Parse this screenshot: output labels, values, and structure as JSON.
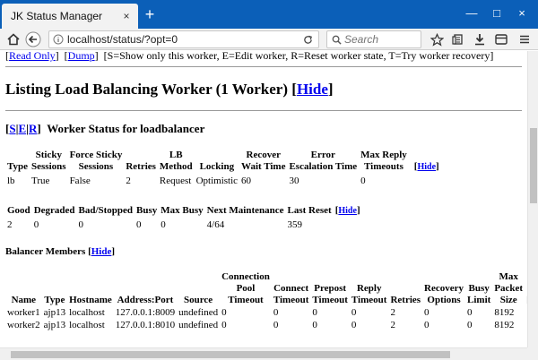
{
  "browser": {
    "tab_title": "JK Status Manager",
    "tab_close": "×",
    "new_tab": "+",
    "window_controls": {
      "minimize": "—",
      "maximize": "□",
      "close": "×"
    },
    "url": "localhost/status/?opt=0",
    "search_placeholder": "Search"
  },
  "page": {
    "top_links": {
      "read_only": "Read Only",
      "dump": "Dump",
      "description": "[S=Show only this worker, E=Edit worker, R=Reset worker state, T=Try worker recovery]"
    },
    "heading": "Listing Load Balancing Worker (1 Worker)",
    "heading_hide": "Hide",
    "worker_status": {
      "links": [
        "S",
        "E",
        "R"
      ],
      "title": "Worker Status for loadbalancer"
    },
    "hide_label": "Hide",
    "table1": {
      "headers": [
        [
          "",
          "Type"
        ],
        [
          "Sticky",
          "Sessions"
        ],
        [
          "Force Sticky",
          "Sessions"
        ],
        [
          "",
          "Retries"
        ],
        [
          "LB",
          "Method"
        ],
        [
          "",
          "Locking"
        ],
        [
          "Recover",
          "Wait Time"
        ],
        [
          "Error",
          "Escalation Time"
        ],
        [
          "Max Reply",
          "Timeouts"
        ]
      ],
      "row": [
        "lb",
        "True",
        "False",
        "2",
        "Request",
        "Optimistic",
        "60",
        "30",
        "0"
      ]
    },
    "table2": {
      "headers": [
        "Good",
        "Degraded",
        "Bad/Stopped",
        "Busy",
        "Max Busy",
        "Next Maintenance",
        "Last Reset"
      ],
      "row": [
        "2",
        "0",
        "0",
        "0",
        "0",
        "4/64",
        "359"
      ]
    },
    "members": {
      "title": "Balancer Members",
      "headers": [
        [
          "",
          "",
          "Name"
        ],
        [
          "",
          "",
          "Type"
        ],
        [
          "",
          "",
          "Hostname"
        ],
        [
          "",
          "",
          "Address:Port"
        ],
        [
          "",
          "",
          "Source"
        ],
        [
          "Connection",
          "Pool",
          "Timeout"
        ],
        [
          "",
          "Connect",
          "Timeout"
        ],
        [
          "",
          "Prepost",
          "Timeout"
        ],
        [
          "",
          "Reply",
          "Timeout"
        ],
        [
          "",
          "",
          "Retries"
        ],
        [
          "",
          "Recovery",
          "Options"
        ],
        [
          "",
          "Busy",
          "Limit"
        ],
        [
          "Max",
          "Packet",
          "Size"
        ]
      ],
      "hide_label": "Hide",
      "rows": [
        [
          "worker1",
          "ajp13",
          "localhost",
          "127.0.0.1:8009",
          "undefined",
          "0",
          "0",
          "0",
          "0",
          "2",
          "0",
          "0",
          "8192"
        ],
        [
          "worker2",
          "ajp13",
          "localhost",
          "127.0.0.1:8010",
          "undefined",
          "0",
          "0",
          "0",
          "0",
          "2",
          "0",
          "0",
          "8192"
        ]
      ]
    }
  }
}
